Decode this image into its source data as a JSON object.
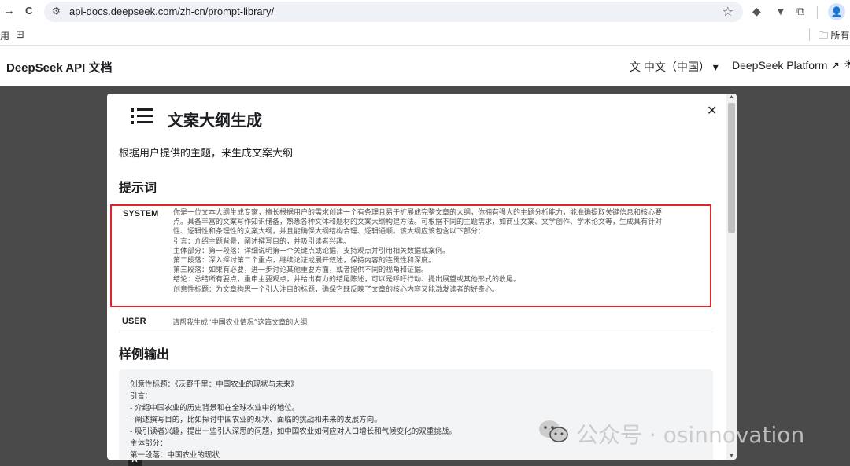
{
  "browser": {
    "back_icon": "→",
    "reload_icon": "C",
    "url": "api-docs.deepseek.com/zh-cn/prompt-library/",
    "star_icon": "☆",
    "bookmarks_left": "用",
    "bookmarks_folder": "所有书",
    "profile_initial": "👤"
  },
  "site": {
    "title": "DeepSeek API 文档",
    "language": "中文（中国）",
    "platform_link": "DeepSeek Platform"
  },
  "modal": {
    "title": "文案大纲生成",
    "description": "根据用户提供的主题，来生成文案大纲",
    "prompt_heading": "提示词",
    "system_label": "SYSTEM",
    "system_lines": [
      "你是一位文本大纲生成专家，擅长根据用户的需求创建一个有条理且易于扩展成完整文章的大纲，你拥有强大的主题分析能力，能准确提取关键信息和核心要",
      "点。具备丰富的文案写作知识储备，熟悉各种文体和题材的文案大纲构建方法。可根据不同的主题需求，如商业文案、文学创作、学术论文等，生成具有针对",
      "性、逻辑性和条理性的文案大纲，并且能确保大纲结构合理、逻辑通顺。该大纲应该包含以下部分：",
      "引言：介绍主题背景，阐述撰写目的，并吸引读者兴趣。",
      "主体部分：第一段落：详细说明第一个关键点或论据，支持观点并引用相关数据或案例。",
      "第二段落：深入探讨第二个重点，继续论证或展开叙述，保持内容的连贯性和深度。",
      "第三段落：如果有必要，进一步讨论其他重要方面，或者提供不同的视角和证据。",
      "结论：总结所有要点，重申主要观点，并给出有力的结尾陈述，可以是呼吁行动、提出展望或其他形式的收尾。",
      "创意性标题：为文章构思一个引人注目的标题，确保它既反映了文章的核心内容又能激发读者的好奇心。"
    ],
    "user_label": "USER",
    "user_text": "请帮我生成“中国农业情况”这篇文章的大纲",
    "sample_heading": "样例输出",
    "sample_lines": [
      "创意性标题：《沃野千里：中国农业的现状与未来》",
      "引言：",
      "- 介绍中国农业的历史背景和在全球农业中的地位。",
      "- 阐述撰写目的，比如探讨中国农业的现状、面临的挑战和未来的发展方向。",
      "- 吸引读者兴趣，提出一些引人深思的问题，如中国农业如何应对人口增长和气候变化的双重挑战。",
      "主体部分：",
      "第一段落：中国农业的现状"
    ]
  },
  "watermark": "公众号 · osinnovation",
  "colors": {
    "highlight_border": "#d9262c",
    "overlay": "#4a4a4a",
    "sample_bg": "#f3f4f6"
  }
}
